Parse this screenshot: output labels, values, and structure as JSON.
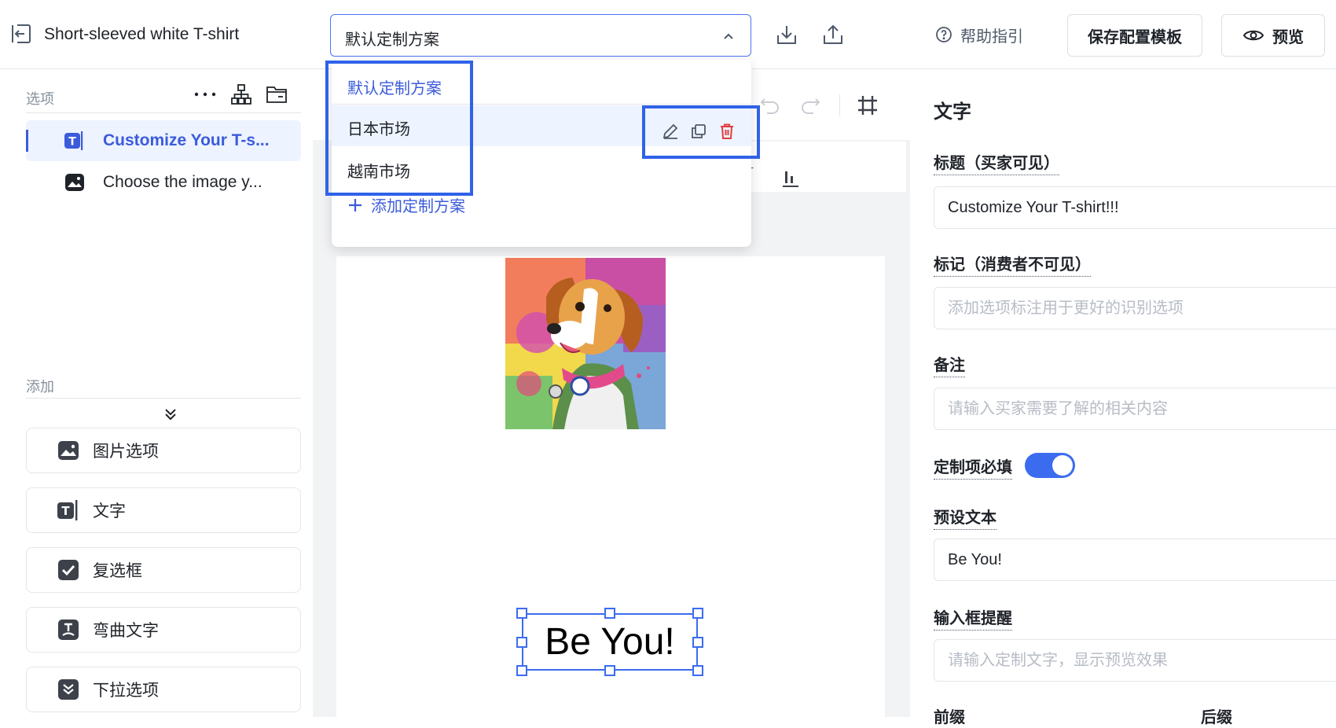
{
  "header": {
    "product_title": "Short-sleeved white T-shirt",
    "scheme_selected": "默认定制方案",
    "help_label": "帮助指引",
    "save_template_label": "保存配置模板",
    "preview_label": "预览"
  },
  "scheme_menu": {
    "items": [
      {
        "label": "默认定制方案",
        "state": "selected"
      },
      {
        "label": "日本市场",
        "state": "hovered"
      },
      {
        "label": "越南市场",
        "state": "normal"
      }
    ],
    "add_label": "添加定制方案",
    "row_actions": [
      "edit-icon",
      "copy-icon",
      "delete-icon"
    ]
  },
  "left_panel": {
    "options_header": "选项",
    "options": [
      {
        "label": "Customize Your T-s...",
        "icon": "text-icon",
        "active": true
      },
      {
        "label": "Choose the image y...",
        "icon": "image-icon",
        "active": false
      }
    ],
    "add_header": "添加",
    "add_items": [
      {
        "label": "图片选项",
        "icon": "image-icon"
      },
      {
        "label": "文字",
        "icon": "text-icon"
      },
      {
        "label": "复选框",
        "icon": "checkbox-icon"
      },
      {
        "label": "弯曲文字",
        "icon": "curved-text-icon"
      },
      {
        "label": "下拉选项",
        "icon": "dropdown-icon"
      }
    ]
  },
  "canvas": {
    "text": "Be You!"
  },
  "right_panel": {
    "title": "文字",
    "fields": {
      "title_label": "标题（买家可见）",
      "title_value": "Customize Your T-shirt!!!",
      "tag_label": "标记（消费者不可见）",
      "tag_placeholder": "添加选项标注用于更好的识别选项",
      "note_label": "备注",
      "note_placeholder": "请输入买家需要了解的相关内容",
      "required_label": "定制项必填",
      "required_on": true,
      "preset_label": "预设文本",
      "preset_value": "Be You!",
      "hint_label": "输入框提醒",
      "hint_placeholder": "请输入定制文字，显示预览效果",
      "prefix_label": "前缀",
      "suffix_label": "后缀"
    }
  },
  "colors": {
    "accent": "#3b5bdb",
    "highlight_box": "#2f62e8",
    "delete": "#e03e3e"
  }
}
